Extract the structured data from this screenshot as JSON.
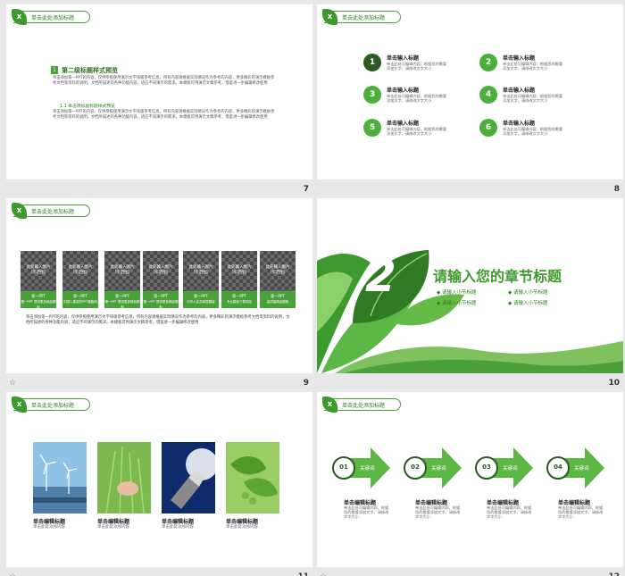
{
  "header_label": "单击此处添加标题",
  "header_leaf": "X",
  "star": "☆",
  "slides": {
    "s7": {
      "number": "7",
      "section_num": "1",
      "section_title": "第二级标题样式预览",
      "para1": "单击添加第一PPT的内容，仅供参照使用演示文字排版参考信息，所有内容请根据实际情况作为参考的内容，更多精彩的演示模板参考文档等资料的说明，文档所描述的各种功能内容，适应不同演示的需求。本模板可用演示文稿参考，借鉴进一步编辑修改使用",
      "sub_title": "1.1 单击添加副标题样式预览",
      "para2": "单击添加第一PPT的内容，仅供参照使用演示文字排版参考信息，所有内容请根据实际情况作为参考的内容，更多精彩的演示模板参考文档等资料的说明，文档所描述的各种功能内容，适应不同演示的需求。本模板可用演示文稿参考，借鉴进一步编辑修改使用"
    },
    "s8": {
      "number": "8",
      "items": [
        {
          "num": "1",
          "title": "单击输入标题",
          "desc": "单击此处可编辑内容，根据您的需要添加文字，请修改文字大小"
        },
        {
          "num": "2",
          "title": "单击输入标题",
          "desc": "单击此处可编辑内容，根据您的需要添加文字，请修改文字大小"
        },
        {
          "num": "3",
          "title": "单击输入标题",
          "desc": "单击此处可编辑内容，根据您的需要添加文字，请修改文字大小"
        },
        {
          "num": "4",
          "title": "单击输入标题",
          "desc": "单击此处可编辑内容，根据您的需要添加文字，请修改文字大小"
        },
        {
          "num": "5",
          "title": "单击输入标题",
          "desc": "单击此处可编辑内容，根据您的需要添加文字，请修改文字大小"
        },
        {
          "num": "6",
          "title": "单击输入标题",
          "desc": "单击此处可编辑内容，根据您的需要添加文字，请修改文字大小"
        }
      ]
    },
    "s9": {
      "number": "9",
      "cards": [
        {
          "ph": "此处输入图片\n（示范图）",
          "label1": "第一PPT",
          "label2": "第一PPT 提供更多精品模板"
        },
        {
          "ph": "此处输入图片\n（示范图）",
          "label1": "第一PPT",
          "label2": "中国人喜欢的PPT模板网"
        },
        {
          "ph": "此处输入图片\n（示范图）",
          "label1": "第一PPT",
          "label2": "第一PPT 提供更多精品模板"
        },
        {
          "ph": "此处输入图片\n（示范图）",
          "label1": "第一PPT",
          "label2": "第一PPT 提供更多精品模板"
        },
        {
          "ph": "此处输入图片\n（示范图）",
          "label1": "第一PPT",
          "label2": "中华人民共和国模板"
        },
        {
          "ph": "此处输入图片\n（示范图）",
          "label1": "第一PPT",
          "label2": "专业模板下载网站"
        },
        {
          "ph": "此处输入图片\n（示范图）",
          "label1": "第一PPT",
          "label2": "高质量精品模板"
        }
      ],
      "para": "单击添加第一PPT的内容，仅供参照使用演示文字排版参考信息，所有内容请根据实际情况作为参考的内容，更多精彩的演示模板参考文档等资料的说明，文档所描述的各种功能内容，适应不同演示的需求。本模板可用演示文稿参考，借鉴进一步编辑修改使用"
    },
    "s10": {
      "number": "10",
      "chapter_num": "2",
      "title": "请输入您的章节标题",
      "bullets": [
        "请输入小节标题",
        "请输入小节标题",
        "请输入小节标题",
        "请输入小节标题"
      ]
    },
    "s11": {
      "number": "11",
      "items": [
        {
          "title": "单击编辑标题",
          "desc": "单击此处添加内容"
        },
        {
          "title": "单击编辑标题",
          "desc": "单击此处添加内容"
        },
        {
          "title": "单击编辑标题",
          "desc": "单击此处添加内容"
        },
        {
          "title": "单击编辑标题",
          "desc": "单击此处添加内容"
        }
      ]
    },
    "s12": {
      "number": "12",
      "items": [
        {
          "num": "01",
          "key": "关键词",
          "title": "单击编辑标题",
          "desc": "单击此处可编辑内容，根据您的需要添加文字，请修改文字大小"
        },
        {
          "num": "02",
          "key": "关键词",
          "title": "单击编辑标题",
          "desc": "单击此处可编辑内容，根据您的需要添加文字，请修改文字大小"
        },
        {
          "num": "03",
          "key": "关键词",
          "title": "单击编辑标题",
          "desc": "单击此处可编辑内容，根据您的需要添加文字，请修改文字大小"
        },
        {
          "num": "04",
          "key": "关键词",
          "title": "单击编辑标题",
          "desc": "单击此处可编辑内容，根据您的需要添加文字，请修改文字大小"
        }
      ]
    }
  },
  "colors": {
    "green": "#4aa13a",
    "dark_green": "#2c5a23",
    "light_green": "#8bc34a"
  }
}
